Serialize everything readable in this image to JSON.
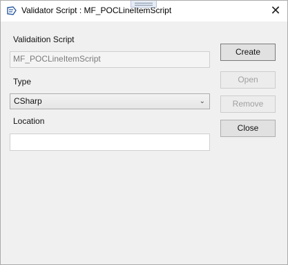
{
  "window": {
    "title": "Validator Script : MF_POCLineItemScript",
    "close_symbol": "✕"
  },
  "form": {
    "script_label": "Validaition Script",
    "script_value": "MF_POCLineItemScript",
    "type_label": "Type",
    "type_value": "CSharp",
    "location_label": "Location",
    "location_value": ""
  },
  "buttons": {
    "create": "Create",
    "open": "Open",
    "remove": "Remove",
    "close": "Close"
  },
  "icons": {
    "title": "script-icon",
    "dropdown": "chevron-down-icon"
  }
}
